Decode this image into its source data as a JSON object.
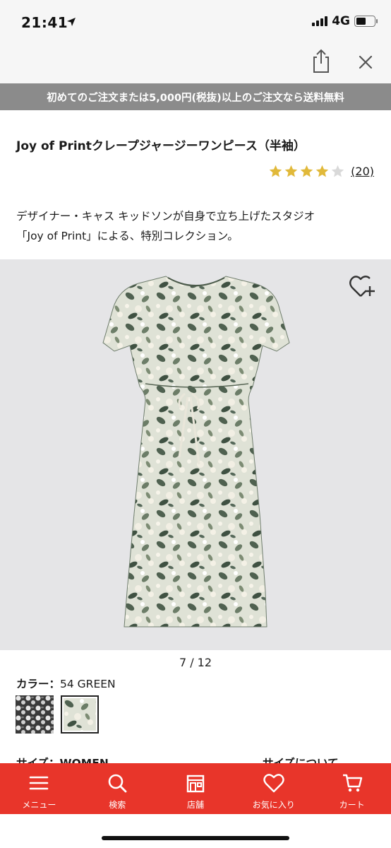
{
  "status_bar": {
    "time": "21:41",
    "network": "4G",
    "icons": [
      "location-arrow-icon",
      "signal-icon",
      "battery-icon"
    ]
  },
  "toolbar": {
    "share_icon": "share-icon",
    "close_icon": "close-icon"
  },
  "banner": {
    "text": "初めてのご注文または5,000円(税抜)以上のご注文なら送料無料"
  },
  "product": {
    "title": "Joy of Printクレープジャージーワンピース（半袖）",
    "rating": 4,
    "rating_max": 5,
    "review_count": "(20)",
    "description_line1": "デザイナー・キャス キッドソンが自身で立ち上げたスタジオ",
    "description_line2": "「Joy of Print」による、特別コレクション。",
    "favorite_icon": "heart-plus-icon",
    "image_pager": "7 / 12"
  },
  "color": {
    "label": "カラー：",
    "selected": "54 GREEN",
    "swatches": [
      "dark-floral",
      "green-floral"
    ]
  },
  "size": {
    "label": "サイズ：WOMEN",
    "link": "サイズについて"
  },
  "bottom_nav": {
    "items": [
      {
        "label": "メニュー",
        "icon": "menu-icon"
      },
      {
        "label": "検索",
        "icon": "search-icon"
      },
      {
        "label": "店舗",
        "icon": "store-icon"
      },
      {
        "label": "お気に入り",
        "icon": "heart-icon"
      },
      {
        "label": "カート",
        "icon": "cart-icon"
      }
    ]
  },
  "colors": {
    "accent": "#e8352a",
    "banner_bg": "#8b8b8b",
    "star": "#e1b93a"
  }
}
